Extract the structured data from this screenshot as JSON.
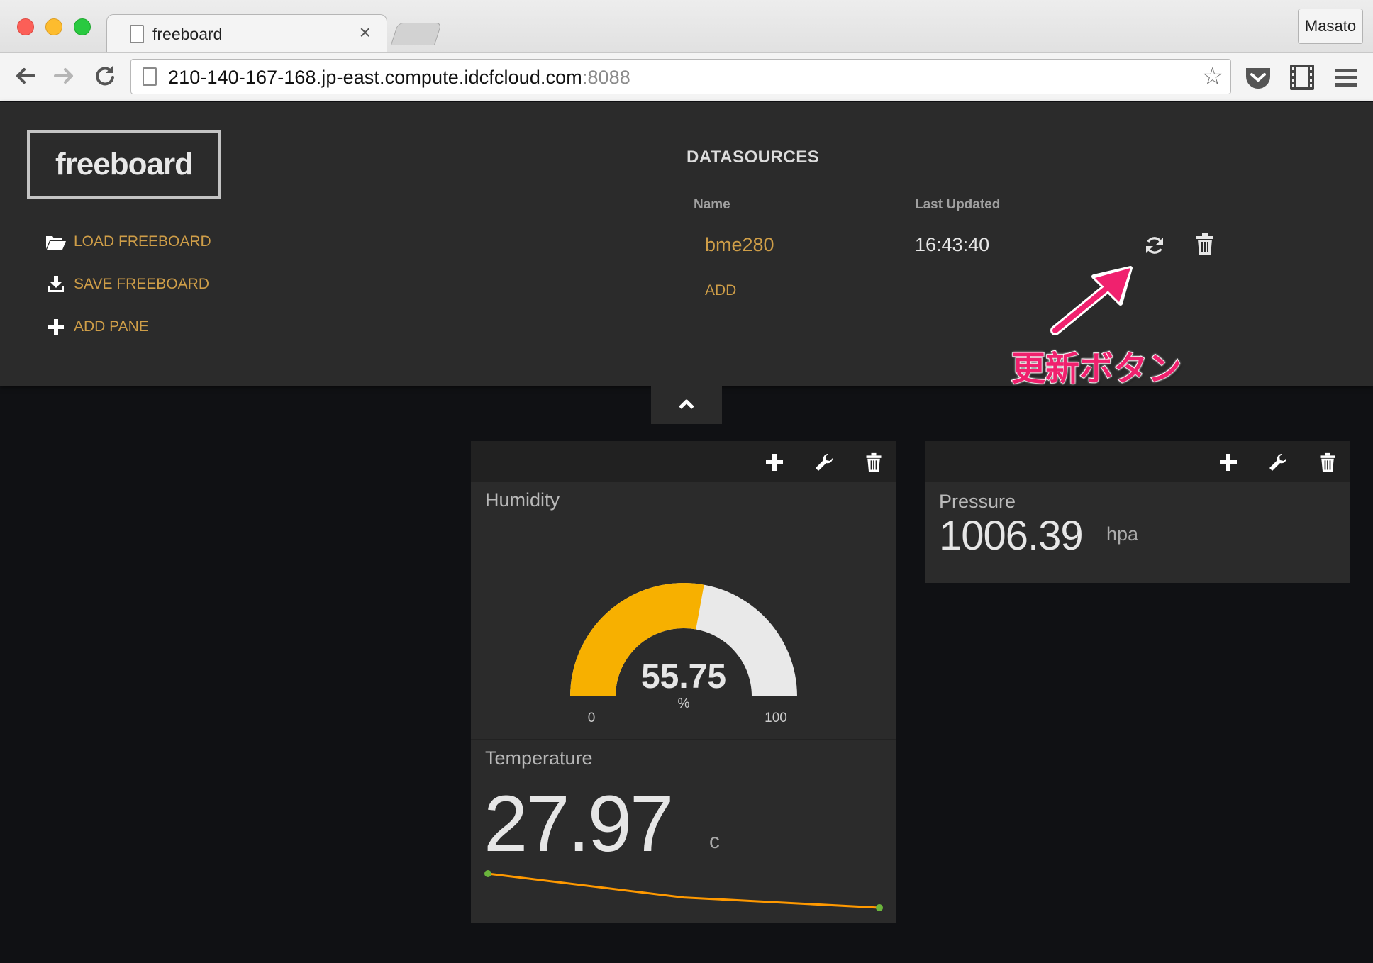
{
  "browser": {
    "tab_title": "freeboard",
    "tab_close": "×",
    "profile_name": "Masato",
    "url_host": "210-140-167-168.jp-east.compute.idcfcloud.com",
    "url_port": ":8088"
  },
  "header": {
    "logo": "freeboard",
    "menu": {
      "load": "LOAD FREEBOARD",
      "save": "SAVE FREEBOARD",
      "add_pane": "ADD PANE"
    }
  },
  "datasources": {
    "title": "DATASOURCES",
    "col_name": "Name",
    "col_updated": "Last Updated",
    "rows": [
      {
        "name": "bme280",
        "last_updated": "16:43:40"
      }
    ],
    "add_label": "ADD"
  },
  "annotation": {
    "text": "更新ボタン",
    "color": "#f0216e"
  },
  "panes": {
    "pane1": {
      "gauge": {
        "title": "Humidity",
        "value": "55.75",
        "value_num": 55.75,
        "unit": "%",
        "min": "0",
        "max": "100",
        "fill_color": "#f7b000",
        "track_color": "#e9e9e9"
      },
      "text_widget": {
        "title": "Temperature",
        "value": "27.97",
        "unit": "c",
        "sparkline_values": [
          28.02,
          27.985,
          27.97
        ],
        "sparkline_color": "#ff9900"
      }
    },
    "pane2": {
      "text_widget": {
        "title": "Pressure",
        "value": "1006.39",
        "unit": "hpa"
      }
    }
  },
  "colors": {
    "accent": "#cf9e48",
    "header_bg": "#2b2b2b",
    "board_bg": "#101114"
  }
}
